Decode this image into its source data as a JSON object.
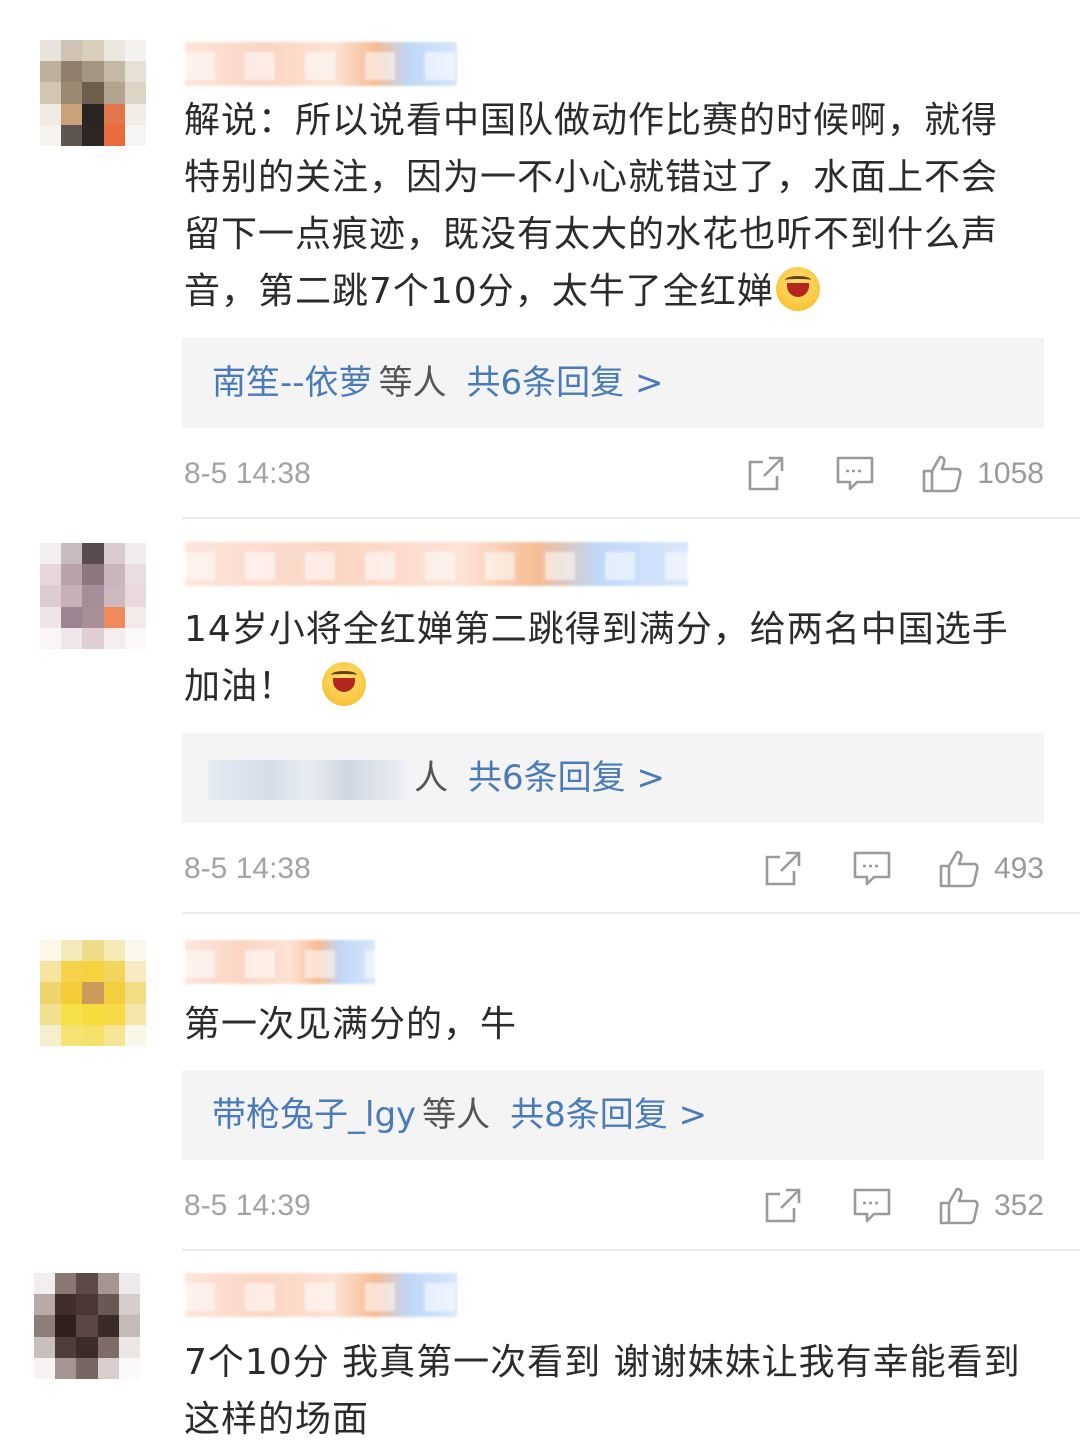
{
  "comments": [
    {
      "text": "解说：所以说看中国队做动作比赛的时候啊，就得特别的关注，因为一不小心就错过了，水面上不会留下一点痕迹，既没有太大的水花也听不到什么声音，第二跳7个10分，太牛了全红婵",
      "reply_users": "南笙--依萝",
      "reply_etc": "等人",
      "reply_count": "共6条回复 >",
      "time": "8-5 14:38",
      "likes": "1058"
    },
    {
      "text": "14岁小将全红婵第二跳得到满分，给两名中国选手加油！",
      "reply_etc": "人",
      "reply_count": "共6条回复 >",
      "time": "8-5 14:38",
      "likes": "493"
    },
    {
      "text": "第一次见满分的，牛",
      "reply_users": "带枪兔子_lgy",
      "reply_etc": "等人",
      "reply_count": "共8条回复 >",
      "time": "8-5 14:39",
      "likes": "352"
    },
    {
      "text": "7个10分 我真第一次看到 谢谢妹妹让我有幸能看到这样的场面"
    }
  ],
  "icons": {
    "share": "share-icon",
    "comment": "comment-icon",
    "like": "thumbs-up-icon",
    "emoji": "laughing-crying-emoji-icon"
  },
  "colors": {
    "link": "#4a7bb8",
    "meta": "#a3a3a3",
    "reply_bg": "#f4f4f4"
  }
}
